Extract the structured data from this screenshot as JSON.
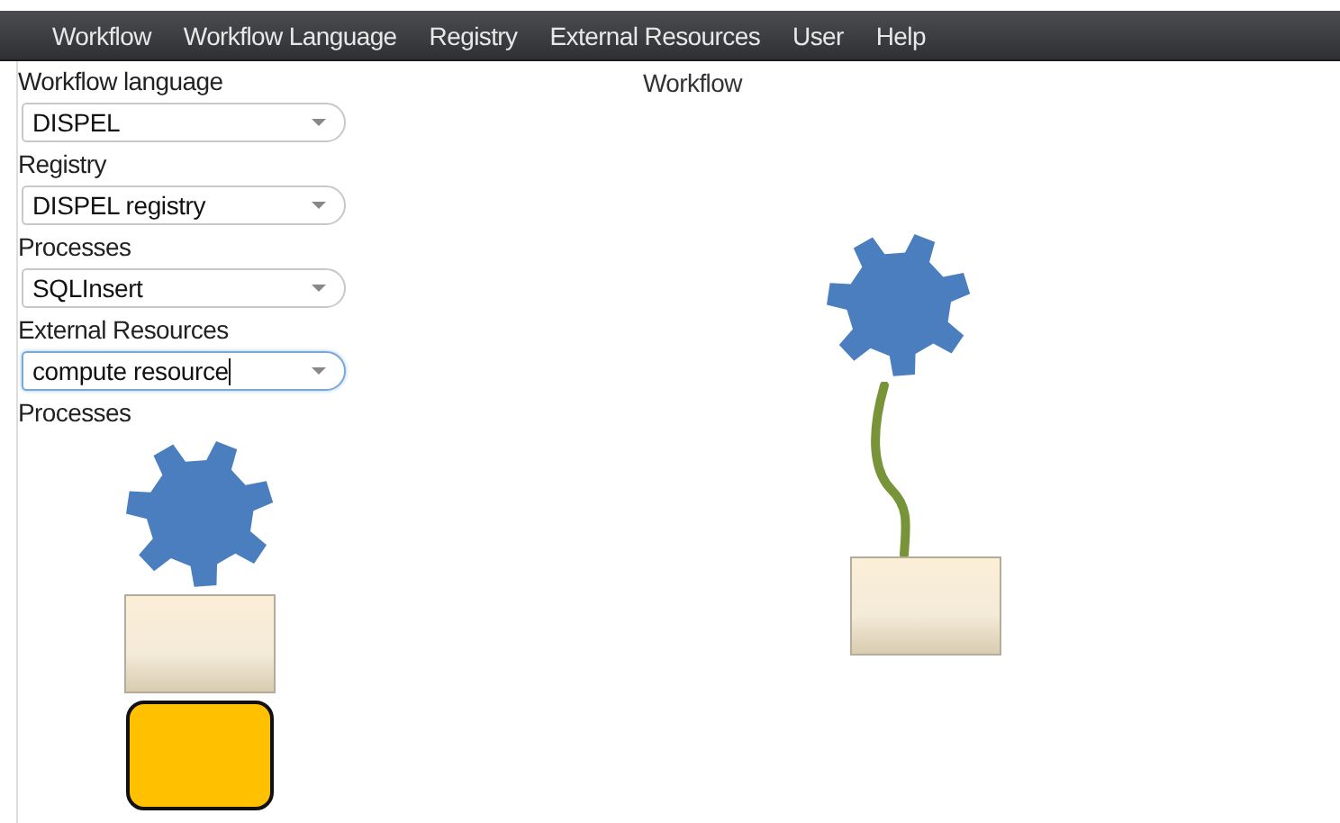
{
  "menu": [
    {
      "label": "Workflow"
    },
    {
      "label": "Workflow Language"
    },
    {
      "label": "Registry"
    },
    {
      "label": "External Resources"
    },
    {
      "label": "User"
    },
    {
      "label": "Help"
    }
  ],
  "sidebar": {
    "fields": [
      {
        "label": "Workflow language",
        "value": "DISPEL",
        "focused": false
      },
      {
        "label": "Registry",
        "value": "DISPEL registry",
        "focused": false
      },
      {
        "label": "Processes",
        "value": "SQLInsert",
        "focused": false
      },
      {
        "label": "External Resources",
        "value": "compute resource",
        "focused": true
      }
    ],
    "palette_title": "Processes",
    "palette": [
      {
        "kind": "gear"
      },
      {
        "kind": "box"
      },
      {
        "kind": "rounded"
      }
    ]
  },
  "canvas": {
    "title": "Workflow",
    "nodes": [
      {
        "kind": "gear"
      },
      {
        "kind": "connector"
      },
      {
        "kind": "box"
      }
    ]
  }
}
